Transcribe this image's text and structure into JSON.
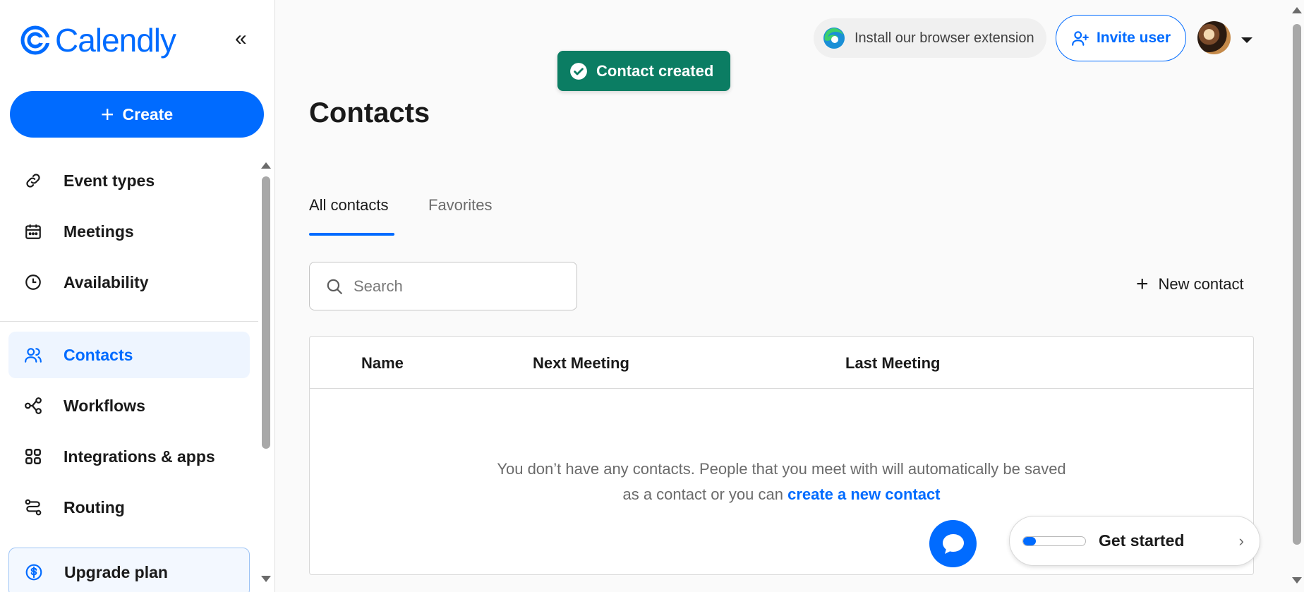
{
  "brand": {
    "name": "Calendly",
    "color": "#006bff"
  },
  "sidebar": {
    "collapse_icon": "double-chevron-left-icon",
    "create_label": "Create",
    "items": [
      {
        "label": "Event types",
        "icon": "link-icon"
      },
      {
        "label": "Meetings",
        "icon": "calendar-icon"
      },
      {
        "label": "Availability",
        "icon": "clock-icon"
      },
      {
        "label": "Contacts",
        "icon": "contacts-icon",
        "active": true
      },
      {
        "label": "Workflows",
        "icon": "workflow-icon"
      },
      {
        "label": "Integrations & apps",
        "icon": "grid-icon"
      },
      {
        "label": "Routing",
        "icon": "routing-icon"
      },
      {
        "label": "Upgrade plan",
        "icon": "dollar-icon"
      }
    ]
  },
  "topbar": {
    "extension_label": "Install our browser extension",
    "invite_label": "Invite user"
  },
  "toast": {
    "label": "Contact created",
    "color": "#0b7d63"
  },
  "main": {
    "title": "Contacts",
    "tabs": [
      {
        "label": "All contacts",
        "active": true
      },
      {
        "label": "Favorites",
        "active": false
      }
    ],
    "search": {
      "placeholder": "Search",
      "value": ""
    },
    "new_contact_label": "New contact",
    "table": {
      "columns": [
        "Name",
        "Next Meeting",
        "Last Meeting"
      ],
      "rows": [],
      "empty_text_1": "You don’t have any contacts. People that you meet with will automatically be saved",
      "empty_text_2": "as a contact or you can",
      "empty_link": "create a new contact"
    }
  },
  "get_started": {
    "label": "Get started",
    "progress": 0.2
  },
  "chat_icon": "chat-bubble-icon"
}
